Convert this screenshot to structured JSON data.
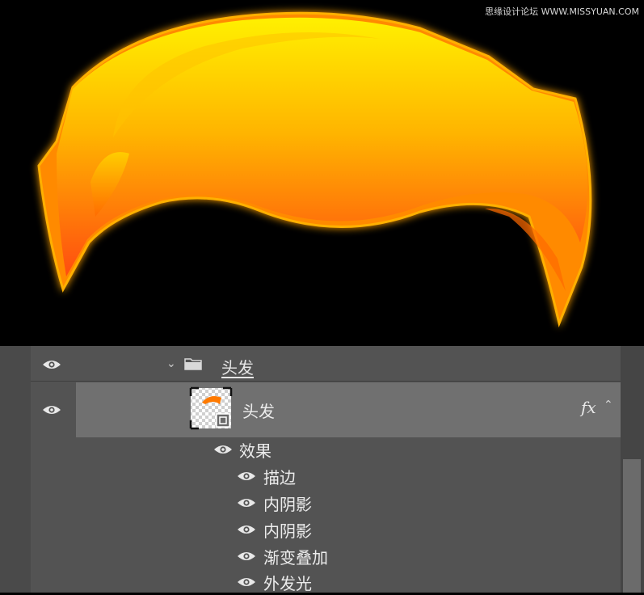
{
  "watermark": "思缘设计论坛 WWW.MISSYUAN.COM",
  "canvas": {
    "artwork": "hair-shape",
    "colors": {
      "top": "#ffe600",
      "bottom": "#ff4a10",
      "glow": "#ffae00",
      "background": "#000000"
    }
  },
  "layers": {
    "group": {
      "name": "头发",
      "icon": "folder-icon",
      "expanded": true
    },
    "layer": {
      "name": "头发",
      "fx_label": "fx",
      "selected": true
    },
    "effects_header": "效果",
    "effects": [
      "描边",
      "内阴影",
      "内阴影",
      "渐变叠加",
      "外发光"
    ]
  }
}
